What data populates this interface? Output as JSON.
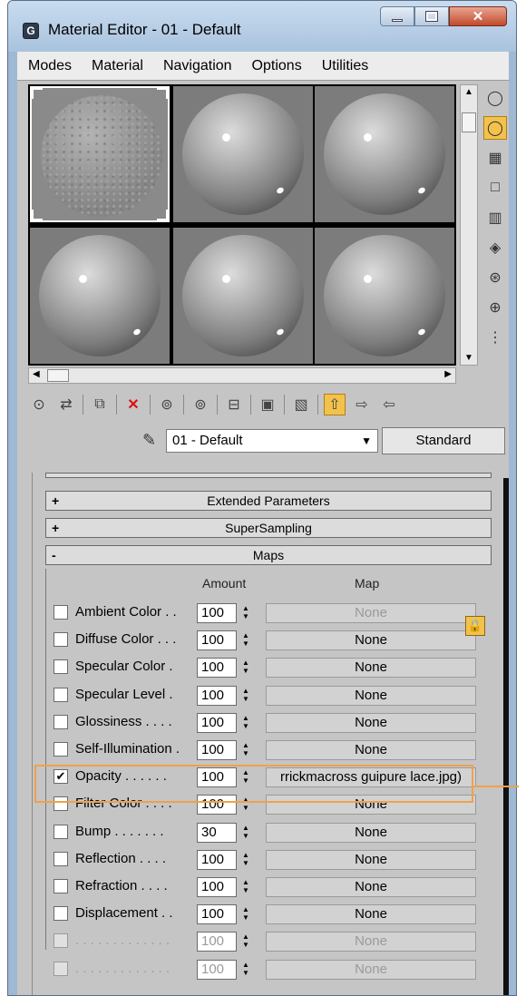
{
  "window": {
    "title": "Material Editor - 01 - Default",
    "icon": "app-logo-icon"
  },
  "menu": [
    "Modes",
    "Material",
    "Navigation",
    "Options",
    "Utilities"
  ],
  "material": {
    "name": "01 - Default",
    "type": "Standard"
  },
  "rollouts": {
    "extended": {
      "sign": "+",
      "label": "Extended Parameters"
    },
    "supersampling": {
      "sign": "+",
      "label": "SuperSampling"
    },
    "maps": {
      "sign": "-",
      "label": "Maps"
    }
  },
  "maps": {
    "amount_header": "Amount",
    "map_header": "Map",
    "rows": [
      {
        "label": "Ambient Color . .",
        "amount": "100",
        "map": "None",
        "checked": false,
        "disabled": false,
        "map_disabled": true
      },
      {
        "label": "Diffuse Color . . .",
        "amount": "100",
        "map": "None",
        "checked": false,
        "disabled": false,
        "map_disabled": false
      },
      {
        "label": "Specular Color .",
        "amount": "100",
        "map": "None",
        "checked": false,
        "disabled": false,
        "map_disabled": false
      },
      {
        "label": "Specular Level .",
        "amount": "100",
        "map": "None",
        "checked": false,
        "disabled": false,
        "map_disabled": false
      },
      {
        "label": "Glossiness . . . .",
        "amount": "100",
        "map": "None",
        "checked": false,
        "disabled": false,
        "map_disabled": false
      },
      {
        "label": "Self-Illumination .",
        "amount": "100",
        "map": "None",
        "checked": false,
        "disabled": false,
        "map_disabled": false
      },
      {
        "label": "Opacity . . . . . .",
        "amount": "100",
        "map": "rrickmacross guipure lace.jpg)",
        "checked": true,
        "disabled": false,
        "map_disabled": false
      },
      {
        "label": "Filter Color . . . .",
        "amount": "100",
        "map": "None",
        "checked": false,
        "disabled": false,
        "map_disabled": false
      },
      {
        "label": "Bump . . . . . . .",
        "amount": "30",
        "map": "None",
        "checked": false,
        "disabled": false,
        "map_disabled": false
      },
      {
        "label": "Reflection . . . .",
        "amount": "100",
        "map": "None",
        "checked": false,
        "disabled": false,
        "map_disabled": false
      },
      {
        "label": "Refraction . . . .",
        "amount": "100",
        "map": "None",
        "checked": false,
        "disabled": false,
        "map_disabled": false
      },
      {
        "label": "Displacement . .",
        "amount": "100",
        "map": "None",
        "checked": false,
        "disabled": false,
        "map_disabled": false
      },
      {
        "label": ". . . . . . . . . . . . .",
        "amount": "100",
        "map": "None",
        "checked": false,
        "disabled": true,
        "map_disabled": true
      },
      {
        "label": ". . . . . . . . . . . . .",
        "amount": "100",
        "map": "None",
        "checked": false,
        "disabled": true,
        "map_disabled": true
      }
    ]
  },
  "highlight_color": "#f0a14a",
  "active_color": "#f3c24d"
}
